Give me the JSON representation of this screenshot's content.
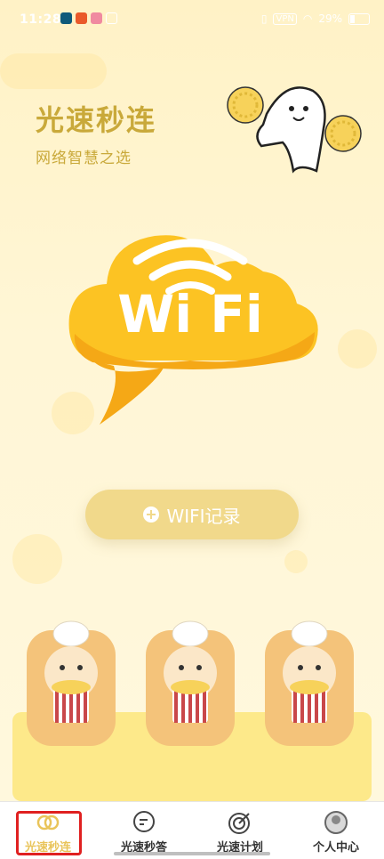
{
  "status_bar": {
    "time": "11:28",
    "network_label": "VPN",
    "battery": "29%"
  },
  "header": {
    "title": "光速秒连",
    "subtitle": "网络智慧之选"
  },
  "hero": {
    "wifi_text": "Wi Fi"
  },
  "actions": {
    "record_label": "WIFI记录"
  },
  "tabs": [
    {
      "label": "光速秒连",
      "icon": "double-circle-icon",
      "active": true
    },
    {
      "label": "光速秒答",
      "icon": "chat-bubble-icon",
      "active": false
    },
    {
      "label": "光速计划",
      "icon": "target-icon",
      "active": false
    },
    {
      "label": "个人中心",
      "icon": "person-icon",
      "active": false
    }
  ],
  "colors": {
    "accent": "#e9c45a",
    "title": "#c9a93a",
    "cloud": "#fcc323",
    "button": "#f1d98b",
    "highlight": "#e02020"
  }
}
